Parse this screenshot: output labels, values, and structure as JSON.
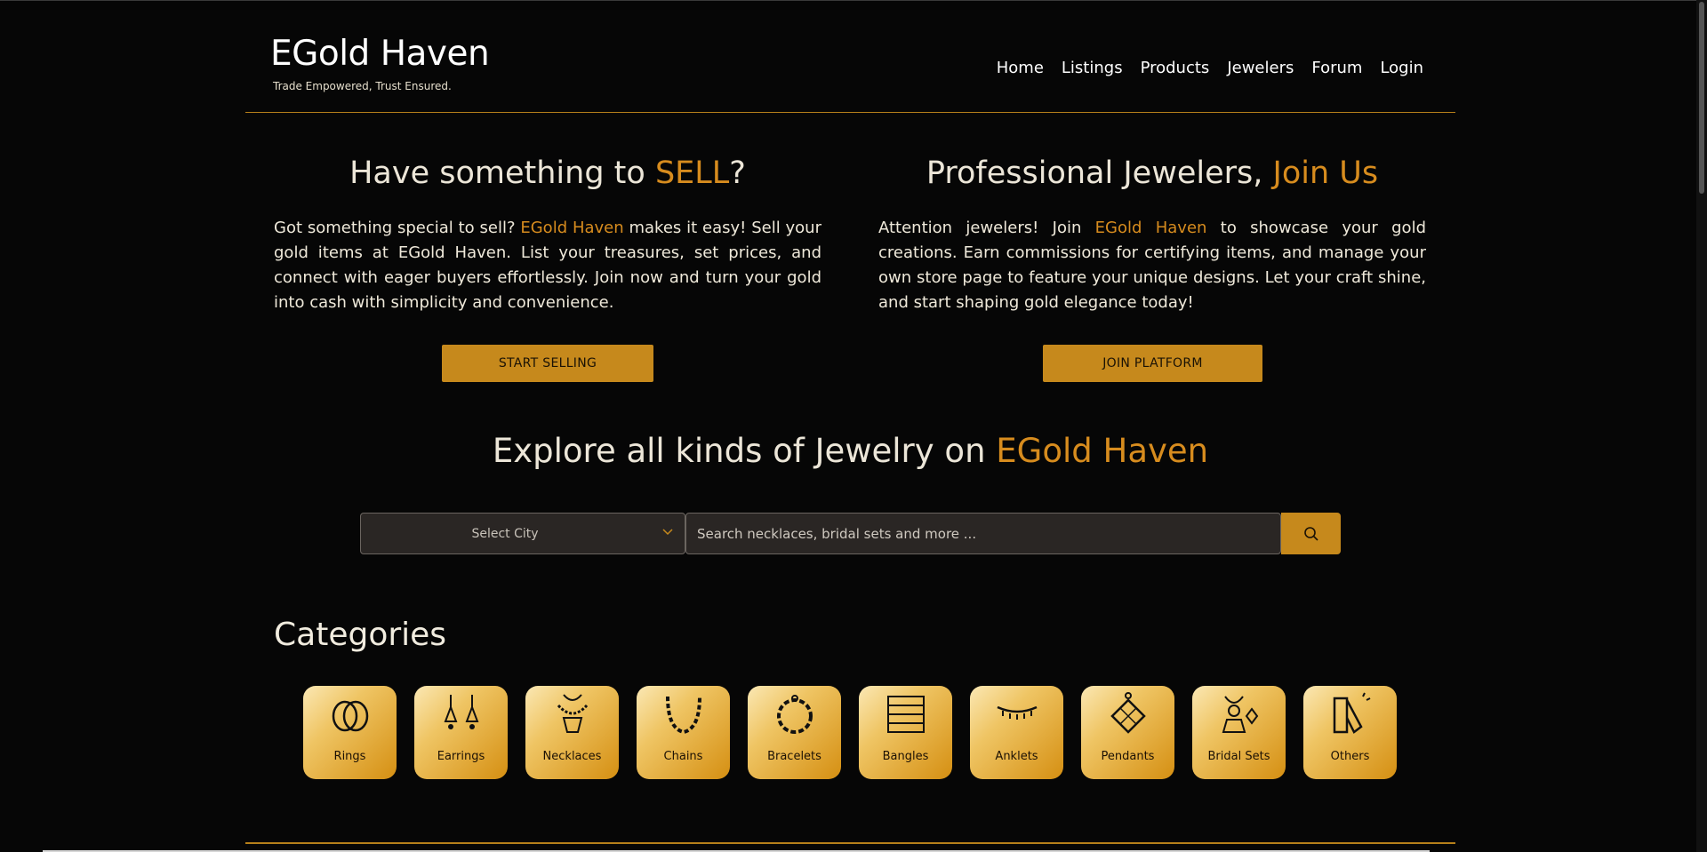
{
  "brand": {
    "title": "EGold Haven",
    "tagline": "Trade Empowered, Trust Ensured."
  },
  "nav": [
    "Home",
    "Listings",
    "Products",
    "Jewelers",
    "Forum",
    "Login"
  ],
  "sell": {
    "heading_pre": "Have something to ",
    "heading_accent": "SELL",
    "heading_post": "?",
    "body_pre": "Got something special to sell? ",
    "body_accent": "EGold Haven",
    "body_post": " makes it easy! Sell your gold items at EGold Haven. List your treasures, set prices, and connect with eager buyers effortlessly. Join now and turn your gold into cash with simplicity and convenience.",
    "button": "START SELLING"
  },
  "join": {
    "heading_pre": "Professional Jewelers, ",
    "heading_accent": "Join Us",
    "body_pre": "Attention jewelers! Join ",
    "body_accent": "EGold Haven",
    "body_post": " to showcase your gold creations. Earn commissions for certifying items, and manage your own store page to feature your unique designs. Let your craft shine, and start shaping gold elegance today!",
    "button": "JOIN PLATFORM"
  },
  "explore": {
    "pre": "Explore all kinds of Jewelry on ",
    "accent": "EGold Haven"
  },
  "search": {
    "city": "Select City",
    "placeholder": "Search necklaces, bridal sets and more ...",
    "icon": "search-icon"
  },
  "categories": {
    "title": "Categories",
    "items": [
      "Rings",
      "Earrings",
      "Necklaces",
      "Chains",
      "Bracelets",
      "Bangles",
      "Anklets",
      "Pendants",
      "Bridal Sets",
      "Others"
    ]
  },
  "colors": {
    "accent": "#d78c1e",
    "button": "#c6891c",
    "background": "#060606"
  }
}
